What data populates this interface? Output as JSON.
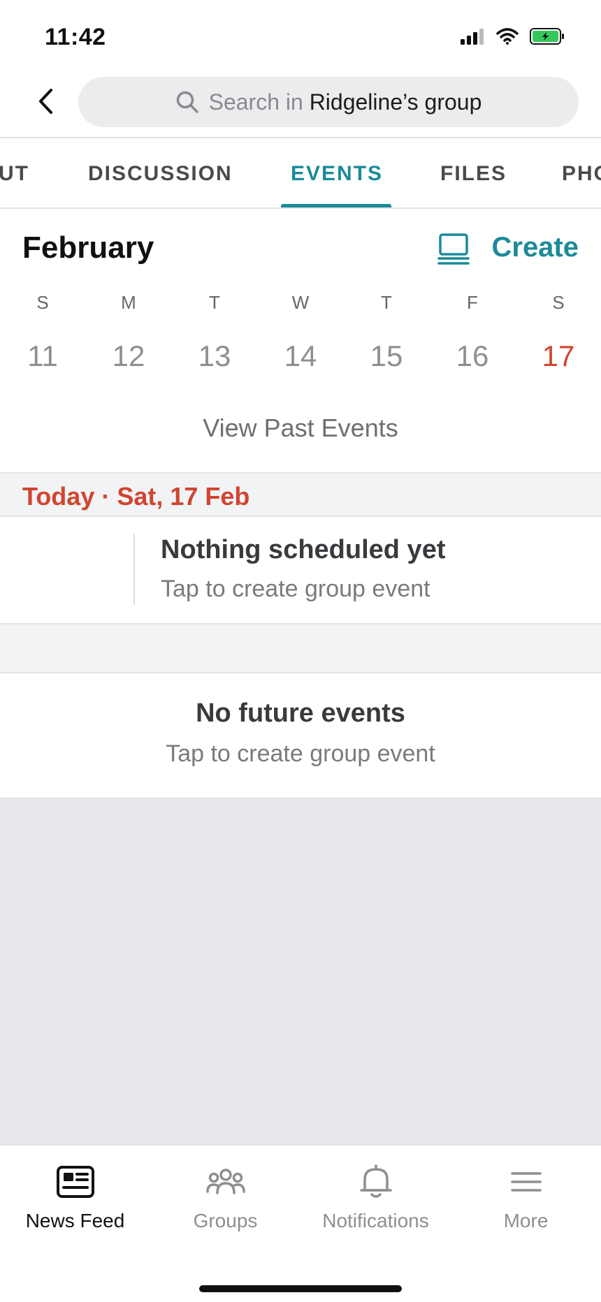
{
  "status_bar": {
    "time": "11:42"
  },
  "search": {
    "prefix": "Search in ",
    "group_name": "Ridgeline’s group"
  },
  "tabs": [
    {
      "label": "UT",
      "active": false
    },
    {
      "label": "DISCUSSION",
      "active": false
    },
    {
      "label": "EVENTS",
      "active": true
    },
    {
      "label": "FILES",
      "active": false
    },
    {
      "label": "PHO",
      "active": false
    }
  ],
  "calendar": {
    "month": "February",
    "create_label": "Create",
    "week_letters": [
      "S",
      "M",
      "T",
      "W",
      "T",
      "F",
      "S"
    ],
    "week_dates": [
      "11",
      "12",
      "13",
      "14",
      "15",
      "16",
      "17"
    ],
    "today_index": 6,
    "view_past_label": "View Past Events"
  },
  "today": {
    "label": "Today · Sat, 17 Feb",
    "empty_title": "Nothing scheduled yet",
    "empty_subtitle": "Tap to create group event"
  },
  "future": {
    "title": "No future events",
    "subtitle": "Tap to create group event"
  },
  "bottom_nav": [
    {
      "label": "News Feed",
      "icon": "news-feed-icon",
      "active": true
    },
    {
      "label": "Groups",
      "icon": "groups-icon",
      "active": false
    },
    {
      "label": "Notifications",
      "icon": "bell-icon",
      "active": false
    },
    {
      "label": "More",
      "icon": "menu-icon",
      "active": false
    }
  ],
  "colors": {
    "accent": "#1b8a99",
    "today_red": "#d0452f",
    "band_gray": "#f2f3f5",
    "empty_gray": "#e7e9ec"
  }
}
